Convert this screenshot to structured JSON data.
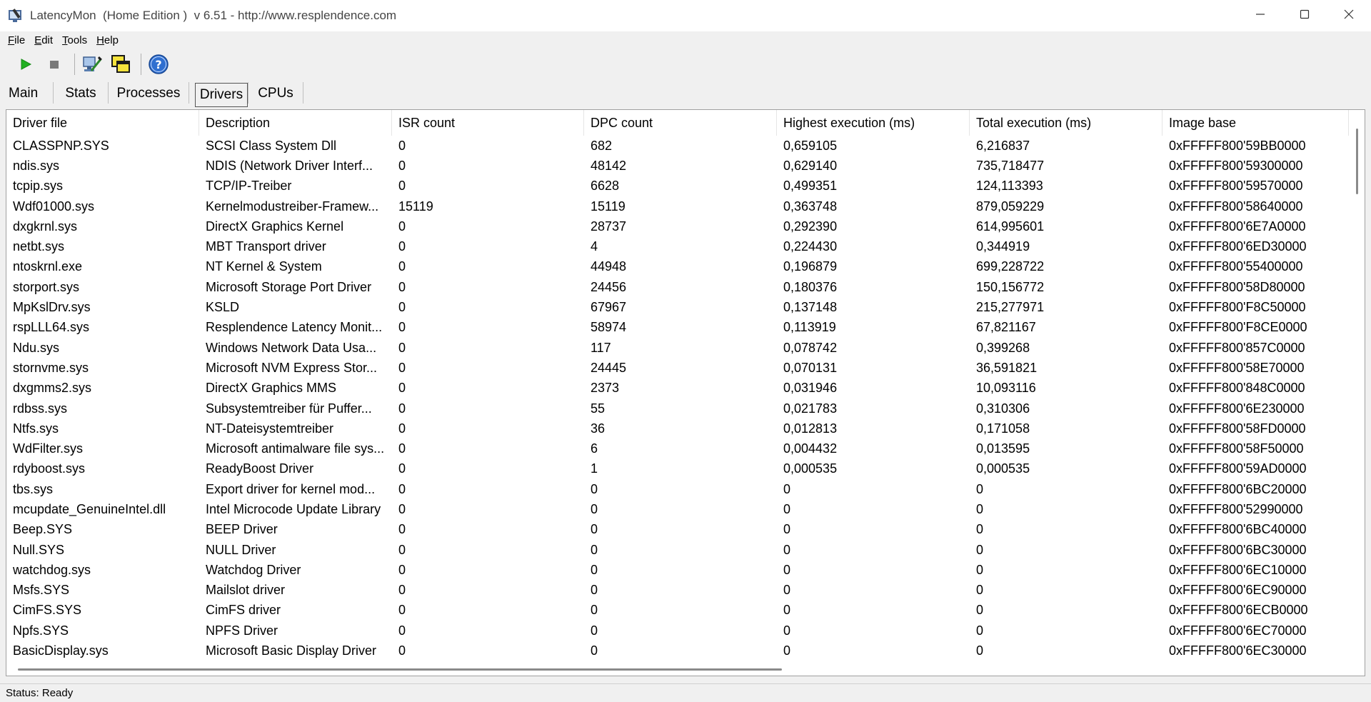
{
  "window": {
    "title": "LatencyMon  (Home Edition )  v 6.51 - http://www.resplendence.com",
    "controls": [
      "minimize-icon",
      "maximize-icon",
      "close-icon"
    ]
  },
  "menu": [
    {
      "accel": "F",
      "rest": "ile"
    },
    {
      "accel": "E",
      "rest": "dit"
    },
    {
      "accel": "T",
      "rest": "ools"
    },
    {
      "accel": "H",
      "rest": "elp"
    }
  ],
  "toolbar": {
    "icons": [
      "play-icon",
      "stop-icon",
      "analyze-icon",
      "windows-icon",
      "help-icon"
    ],
    "colors": {
      "play": "#22b022",
      "stop": "#7a7a7a",
      "help": "#2f6fd0"
    }
  },
  "tabs": [
    {
      "label": "Main"
    },
    {
      "label": "Stats"
    },
    {
      "label": "Processes"
    },
    {
      "label": "Drivers",
      "active": true
    },
    {
      "label": "CPUs"
    }
  ],
  "table": {
    "columns": [
      "Driver file",
      "Description",
      "ISR count",
      "DPC count",
      "Highest execution (ms)",
      "Total execution (ms)",
      "Image base"
    ],
    "rows": [
      [
        "CLASSPNP.SYS",
        "SCSI Class System Dll",
        "0",
        "682",
        "0,659105",
        "6,216837",
        "0xFFFFF800'59BB0000"
      ],
      [
        "ndis.sys",
        "NDIS (Network Driver Interf...",
        "0",
        "48142",
        "0,629140",
        "735,718477",
        "0xFFFFF800'59300000"
      ],
      [
        "tcpip.sys",
        "TCP/IP-Treiber",
        "0",
        "6628",
        "0,499351",
        "124,113393",
        "0xFFFFF800'59570000"
      ],
      [
        "Wdf01000.sys",
        "Kernelmodustreiber-Framew...",
        "15119",
        "15119",
        "0,363748",
        "879,059229",
        "0xFFFFF800'58640000"
      ],
      [
        "dxgkrnl.sys",
        "DirectX Graphics Kernel",
        "0",
        "28737",
        "0,292390",
        "614,995601",
        "0xFFFFF800'6E7A0000"
      ],
      [
        "netbt.sys",
        "MBT Transport driver",
        "0",
        "4",
        "0,224430",
        "0,344919",
        "0xFFFFF800'6ED30000"
      ],
      [
        "ntoskrnl.exe",
        "NT Kernel & System",
        "0",
        "44948",
        "0,196879",
        "699,228722",
        "0xFFFFF800'55400000"
      ],
      [
        "storport.sys",
        "Microsoft Storage Port Driver",
        "0",
        "24456",
        "0,180376",
        "150,156772",
        "0xFFFFF800'58D80000"
      ],
      [
        "MpKslDrv.sys",
        "KSLD",
        "0",
        "67967",
        "0,137148",
        "215,277971",
        "0xFFFFF800'F8C50000"
      ],
      [
        "rspLLL64.sys",
        "Resplendence Latency Monit...",
        "0",
        "58974",
        "0,113919",
        "67,821167",
        "0xFFFFF800'F8CE0000"
      ],
      [
        "Ndu.sys",
        "Windows Network Data Usa...",
        "0",
        "117",
        "0,078742",
        "0,399268",
        "0xFFFFF800'857C0000"
      ],
      [
        "stornvme.sys",
        "Microsoft NVM Express Stor...",
        "0",
        "24445",
        "0,070131",
        "36,591821",
        "0xFFFFF800'58E70000"
      ],
      [
        "dxgmms2.sys",
        "DirectX Graphics MMS",
        "0",
        "2373",
        "0,031946",
        "10,093116",
        "0xFFFFF800'848C0000"
      ],
      [
        "rdbss.sys",
        "Subsystemtreiber für Puffer...",
        "0",
        "55",
        "0,021783",
        "0,310306",
        "0xFFFFF800'6E230000"
      ],
      [
        "Ntfs.sys",
        "NT-Dateisystemtreiber",
        "0",
        "36",
        "0,012813",
        "0,171058",
        "0xFFFFF800'58FD0000"
      ],
      [
        "WdFilter.sys",
        "Microsoft antimalware file sys...",
        "0",
        "6",
        "0,004432",
        "0,013595",
        "0xFFFFF800'58F50000"
      ],
      [
        "rdyboost.sys",
        "ReadyBoost Driver",
        "0",
        "1",
        "0,000535",
        "0,000535",
        "0xFFFFF800'59AD0000"
      ],
      [
        "tbs.sys",
        "Export driver for kernel mod...",
        "0",
        "0",
        "0",
        "0",
        "0xFFFFF800'6BC20000"
      ],
      [
        "mcupdate_GenuineIntel.dll",
        "Intel Microcode Update Library",
        "0",
        "0",
        "0",
        "0",
        "0xFFFFF800'52990000"
      ],
      [
        "Beep.SYS",
        "BEEP Driver",
        "0",
        "0",
        "0",
        "0",
        "0xFFFFF800'6BC40000"
      ],
      [
        "Null.SYS",
        "NULL Driver",
        "0",
        "0",
        "0",
        "0",
        "0xFFFFF800'6BC30000"
      ],
      [
        "watchdog.sys",
        "Watchdog Driver",
        "0",
        "0",
        "0",
        "0",
        "0xFFFFF800'6EC10000"
      ],
      [
        "Msfs.SYS",
        "Mailslot driver",
        "0",
        "0",
        "0",
        "0",
        "0xFFFFF800'6EC90000"
      ],
      [
        "CimFS.SYS",
        "CimFS driver",
        "0",
        "0",
        "0",
        "0",
        "0xFFFFF800'6ECB0000"
      ],
      [
        "Npfs.SYS",
        "NPFS Driver",
        "0",
        "0",
        "0",
        "0",
        "0xFFFFF800'6EC70000"
      ],
      [
        "BasicDisplay.sys",
        "Microsoft Basic Display Driver",
        "0",
        "0",
        "0",
        "0",
        "0xFFFFF800'6EC30000"
      ]
    ]
  },
  "status": {
    "text": "Status: Ready"
  }
}
